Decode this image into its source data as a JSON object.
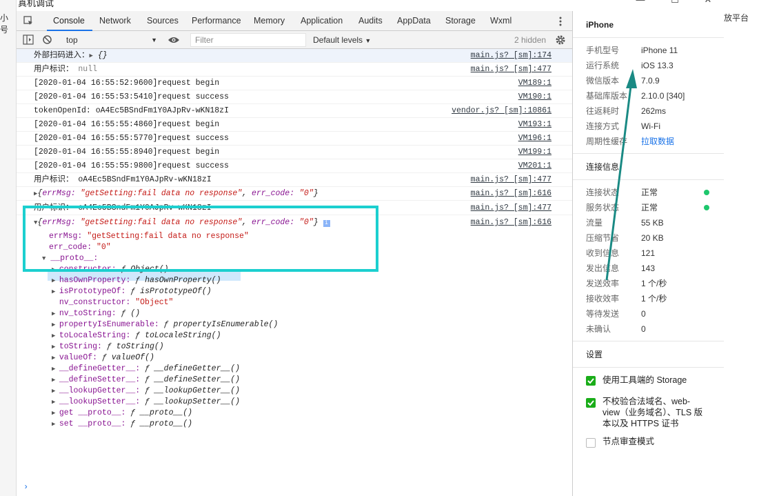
{
  "background": {
    "left_text": "小号",
    "right_text": "放平台"
  },
  "window": {
    "title": "真机调试",
    "minimize": "—",
    "maximize": "☐",
    "close": "✕"
  },
  "tabs": [
    "Console",
    "Network",
    "Sources",
    "Performance",
    "Memory",
    "Application",
    "Audits",
    "AppData",
    "Storage",
    "Wxml"
  ],
  "toolbar": {
    "context": "top",
    "filter_placeholder": "Filter",
    "levels": "Default levels",
    "hidden": "2 hidden"
  },
  "console": {
    "rows": [
      {
        "msg": "外部扫码进入：",
        "obj": "{}",
        "src": "main.js? [sm]:174"
      },
      {
        "msg": "用户标识：",
        "val": "null",
        "src": "main.js? [sm]:477"
      },
      {
        "msg": "[2020-01-04 16:55:52:9600]request begin",
        "src": "VM189:1"
      },
      {
        "msg": "[2020-01-04 16:55:53:5410]request success",
        "src": "VM190:1"
      },
      {
        "msg": "tokenOpenId:",
        "val": "oA4Ec5BSndFm1Y0AJpRv-wKN18zI",
        "src": "vendor.js? [sm]:10861"
      },
      {
        "msg": "[2020-01-04 16:55:55:4860]request begin",
        "src": "VM193:1"
      },
      {
        "msg": "[2020-01-04 16:55:55:5770]request success",
        "src": "VM196:1"
      },
      {
        "msg": "[2020-01-04 16:55:55:8940]request begin",
        "src": "VM199:1"
      },
      {
        "msg": "[2020-01-04 16:55:55:9800]request success",
        "src": "VM201:1"
      },
      {
        "msg": "用户标识：",
        "val": "oA4Ec5BSndFm1Y0AJpRv-wKN18zI",
        "src": "main.js? [sm]:477"
      },
      {
        "obj_key1": "errMsg:",
        "obj_val1": "\"getSetting:fail data no response\"",
        "obj_key2": "err_code:",
        "obj_val2": "\"0\"",
        "src": "main.js? [sm]:616"
      },
      {
        "msg": "用户标识：",
        "val": "oA4Ec5BSndFm1Y0AJpRv-wKN18zI",
        "src": "main.js? [sm]:477"
      },
      {
        "obj_key1": "errMsg:",
        "obj_val1": "\"getSetting:fail data no response\"",
        "obj_key2": "err_code:",
        "obj_val2": "\"0\"",
        "src": "main.js? [sm]:616"
      }
    ],
    "expanded": {
      "errMsg_key": "errMsg:",
      "errMsg_val": "\"getSetting:fail data no response\"",
      "err_code_key": "err_code:",
      "err_code_val": "\"0\"",
      "proto_key": "__proto__:",
      "proto_items": [
        {
          "key": "constructor:",
          "val": "ƒ Object()",
          "expandable": true
        },
        {
          "key": "hasOwnProperty:",
          "val": "ƒ hasOwnProperty()",
          "expandable": true
        },
        {
          "key": "isPrototypeOf:",
          "val": "ƒ isPrototypeOf()",
          "expandable": true
        },
        {
          "key": "nv_constructor:",
          "val": "\"Object\"",
          "expandable": false
        },
        {
          "key": "nv_toString:",
          "val": "ƒ ()",
          "expandable": true
        },
        {
          "key": "propertyIsEnumerable:",
          "val": "ƒ propertyIsEnumerable()",
          "expandable": true
        },
        {
          "key": "toLocaleString:",
          "val": "ƒ toLocaleString()",
          "expandable": true
        },
        {
          "key": "toString:",
          "val": "ƒ toString()",
          "expandable": true
        },
        {
          "key": "valueOf:",
          "val": "ƒ valueOf()",
          "expandable": true
        },
        {
          "key": "__defineGetter__:",
          "val": "ƒ __defineGetter__()",
          "expandable": true
        },
        {
          "key": "__defineSetter__:",
          "val": "ƒ __defineSetter__()",
          "expandable": true
        },
        {
          "key": "__lookupGetter__:",
          "val": "ƒ __lookupGetter__()",
          "expandable": true
        },
        {
          "key": "__lookupSetter__:",
          "val": "ƒ __lookupSetter__()",
          "expandable": true
        },
        {
          "key": "get __proto__:",
          "val": "ƒ __proto__()",
          "expandable": true
        },
        {
          "key": "set __proto__:",
          "val": "ƒ __proto__()",
          "expandable": true
        }
      ]
    },
    "prompt": "›"
  },
  "panel": {
    "device": "iPhone",
    "info": [
      {
        "label": "手机型号",
        "value": "iPhone 11"
      },
      {
        "label": "运行系统",
        "value": "iOS 13.3"
      },
      {
        "label": "微信版本",
        "value": "7.0.9"
      },
      {
        "label": "基础库版本",
        "value": "2.10.0 [340]"
      },
      {
        "label": "往返耗时",
        "value": "262ms"
      },
      {
        "label": "连接方式",
        "value": "Wi-Fi"
      },
      {
        "label": "周期性缓存",
        "value": "拉取数据"
      }
    ],
    "conn_title": "连接信息",
    "conn": [
      {
        "label": "连接状态",
        "value": "正常"
      },
      {
        "label": "服务状态",
        "value": "正常"
      },
      {
        "label": "流量",
        "value": "55 KB"
      },
      {
        "label": "压缩节省",
        "value": "20 KB"
      },
      {
        "label": "收到信息",
        "value": "121"
      },
      {
        "label": "发出信息",
        "value": "143"
      },
      {
        "label": "发送效率",
        "value": "1 个/秒"
      },
      {
        "label": "接收效率",
        "value": "1 个/秒"
      },
      {
        "label": "等待发送",
        "value": "0"
      },
      {
        "label": "未确认",
        "value": "0"
      }
    ],
    "settings_title": "设置",
    "settings": [
      {
        "label": "使用工具端的 Storage",
        "checked": true
      },
      {
        "label_lines": [
          "不校验合法域名、web-",
          "view（业务域名）、TLS 版",
          "本以及 HTTPS 证书"
        ],
        "checked": true
      },
      {
        "label": "节点审查模式",
        "checked": false
      }
    ]
  },
  "colors": {
    "accent": "#1a73e8",
    "highlight": "#1ccfcf",
    "ok": "#1ec76d",
    "check": "#1aad19",
    "string": "#c41a16",
    "key": "#881391"
  }
}
